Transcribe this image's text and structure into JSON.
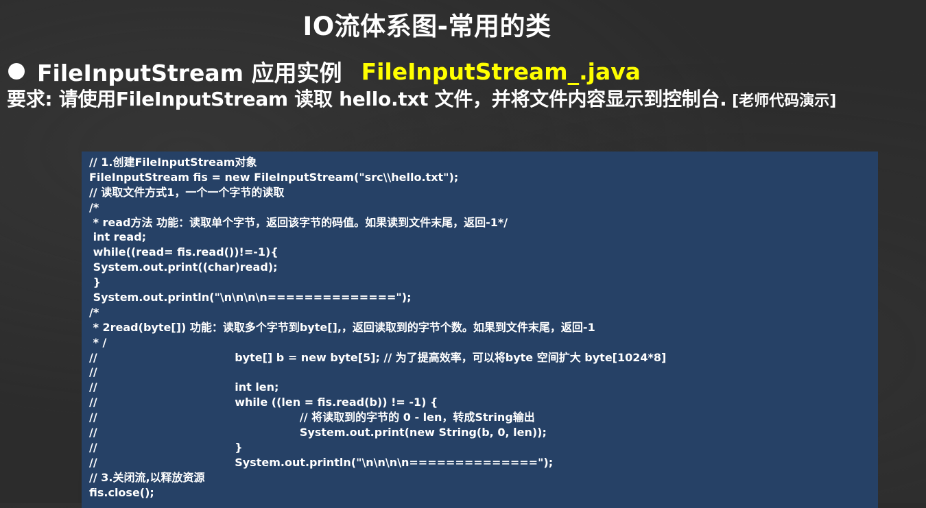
{
  "slide": {
    "title": "IO流体系图-常用的类"
  },
  "bullet": {
    "label": "FileInputStream 应用实例",
    "file": "FileInputStream_.java"
  },
  "requirement": {
    "main": "要求: 请使用FileInputStream 读取 hello.txt 文件，并将文件内容显示到控制台.",
    "note": " [老师代码演示]"
  },
  "code": {
    "lines": [
      "// 1.创建FileInputStream对象",
      "FileInputStream fis = new FileInputStream(\"src\\\\hello.txt\");",
      "// 读取文件方式1，一个一个字节的读取",
      "/*",
      " * read方法 功能：读取单个字节，返回该字节的码值。如果读到文件末尾，返回-1*/",
      " int read;",
      " while((read= fis.read())!=-1){",
      " System.out.print((char)read);",
      " }",
      " System.out.println(\"\\n\\n\\n\\n==============\");",
      "/*",
      " * 2read(byte[]) 功能：读取多个字节到byte[],，返回读取到的字节个数。如果到文件末尾，返回-1",
      " * /",
      "//                                    byte[] b = new byte[5]; // 为了提高效率，可以将byte 空间扩大 byte[1024*8]",
      "//",
      "//                                    int len;",
      "//                                    while ((len = fis.read(b)) != -1) {",
      "//                                                     // 将读取到的字节的 0 - len，转成String输出",
      "//                                                     System.out.print(new String(b, 0, len));",
      "//                                    }",
      "//                                    System.out.println(\"\\n\\n\\n\\n==============\");",
      "// 3.关闭流,以释放资源",
      "fis.close();"
    ]
  },
  "colors": {
    "background": "#2c2c2c",
    "code_panel": "#264166",
    "highlight": "#ffff00",
    "text": "#ffffff"
  }
}
